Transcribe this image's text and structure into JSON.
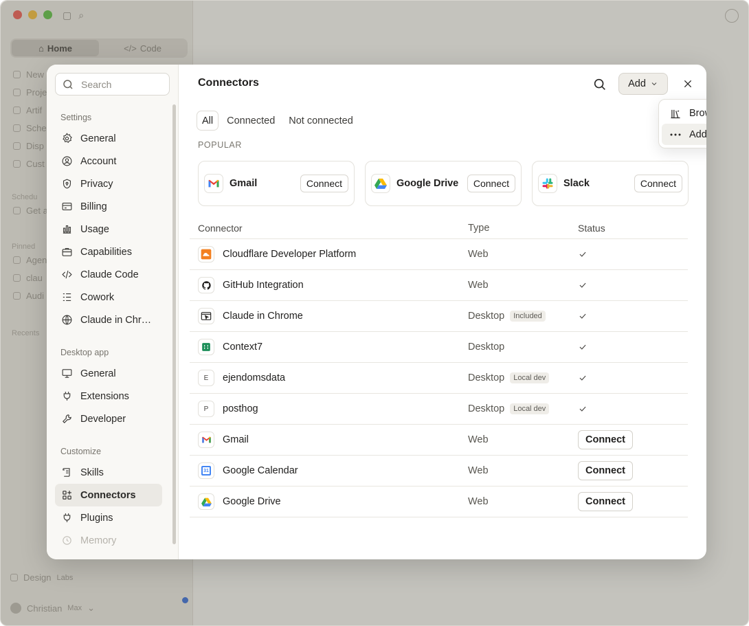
{
  "background_app": {
    "mode_tabs": [
      "Home",
      "Code"
    ],
    "nav": [
      "New",
      "Proje",
      "Artif",
      "Sche",
      "Disp",
      "Cust"
    ],
    "sections": {
      "scheduled": "Schedu",
      "scheduled_item": "Get a",
      "pinned": "Pinned",
      "pinned_items": [
        "Agen",
        "clau",
        "Audi"
      ],
      "recents": "Recents"
    },
    "bottom": {
      "workspace": "Design",
      "workspace_tag": "Labs",
      "user": "Christian",
      "plan": "Max"
    }
  },
  "sidebar": {
    "search_placeholder": "Search",
    "groups": [
      {
        "title": "Settings",
        "items": [
          {
            "label": "General",
            "icon": "gear-icon"
          },
          {
            "label": "Account",
            "icon": "user-circle-icon"
          },
          {
            "label": "Privacy",
            "icon": "shield-icon"
          },
          {
            "label": "Billing",
            "icon": "credit-card-icon"
          },
          {
            "label": "Usage",
            "icon": "bar-chart-icon"
          },
          {
            "label": "Capabilities",
            "icon": "briefcase-icon"
          },
          {
            "label": "Claude Code",
            "icon": "code-icon"
          },
          {
            "label": "Cowork",
            "icon": "checklist-icon"
          },
          {
            "label": "Claude in Chr…",
            "icon": "globe-icon"
          }
        ]
      },
      {
        "title": "Desktop app",
        "items": [
          {
            "label": "General",
            "icon": "monitor-icon"
          },
          {
            "label": "Extensions",
            "icon": "plug-icon"
          },
          {
            "label": "Developer",
            "icon": "wrench-icon"
          }
        ]
      },
      {
        "title": "Customize",
        "items": [
          {
            "label": "Skills",
            "icon": "scroll-icon"
          },
          {
            "label": "Connectors",
            "icon": "grid-plus-icon",
            "active": true
          },
          {
            "label": "Plugins",
            "icon": "plug-icon"
          },
          {
            "label": "Memory",
            "icon": "history-icon"
          }
        ]
      }
    ]
  },
  "header": {
    "title": "Connectors",
    "add_label": "Add"
  },
  "dropdown": {
    "items": [
      {
        "label": "Browse connectors",
        "icon": "library-icon"
      },
      {
        "label": "Add custom connector",
        "icon": "more-dots-icon"
      }
    ]
  },
  "tabs": [
    "All",
    "Connected",
    "Not connected"
  ],
  "popular": {
    "title": "POPULAR",
    "cards": [
      {
        "name": "Gmail",
        "icon": "gmail-icon",
        "action": "Connect"
      },
      {
        "name": "Google Drive",
        "icon": "google-drive-icon",
        "action": "Connect"
      },
      {
        "name": "Slack",
        "icon": "slack-icon",
        "action": "Connect"
      }
    ]
  },
  "table": {
    "headers": {
      "connector": "Connector",
      "type": "Type",
      "status": "Status"
    },
    "connect_label": "Connect",
    "rows": [
      {
        "name": "Cloudflare Developer Platform",
        "type": "Web",
        "tag": "",
        "connected": true,
        "icon": "cloudflare-icon"
      },
      {
        "name": "GitHub Integration",
        "type": "Web",
        "tag": "",
        "connected": true,
        "icon": "github-icon"
      },
      {
        "name": "Claude in Chrome",
        "type": "Desktop",
        "tag": "Included",
        "connected": true,
        "icon": "browser-cursor-icon"
      },
      {
        "name": "Context7",
        "type": "Desktop",
        "tag": "",
        "connected": true,
        "icon": "context7-icon"
      },
      {
        "name": "ejendomsdata",
        "type": "Desktop",
        "tag": "Local dev",
        "connected": true,
        "icon": "letter-e-icon",
        "letter": "E"
      },
      {
        "name": "posthog",
        "type": "Desktop",
        "tag": "Local dev",
        "connected": true,
        "icon": "letter-p-icon",
        "letter": "P"
      },
      {
        "name": "Gmail",
        "type": "Web",
        "tag": "",
        "connected": false,
        "icon": "gmail-icon"
      },
      {
        "name": "Google Calendar",
        "type": "Web",
        "tag": "",
        "connected": false,
        "icon": "google-calendar-icon",
        "letter": "31"
      },
      {
        "name": "Google Drive",
        "type": "Web",
        "tag": "",
        "connected": false,
        "icon": "google-drive-icon"
      }
    ]
  }
}
